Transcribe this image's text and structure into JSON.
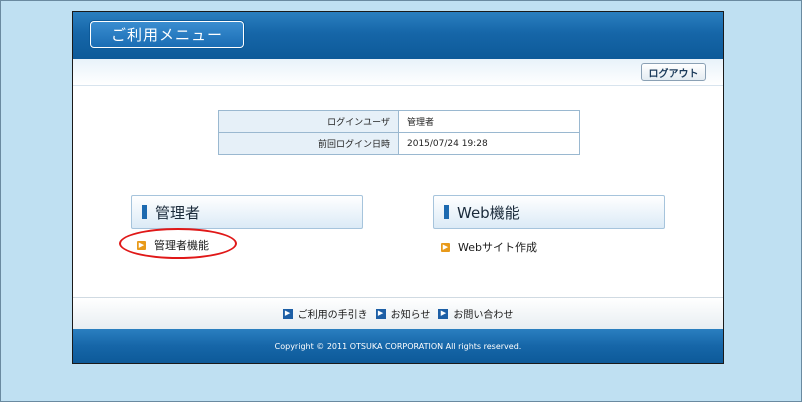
{
  "header": {
    "title": "ご利用メニュー"
  },
  "toolbar": {
    "logout_label": "ログアウト"
  },
  "login_info": {
    "user_label": "ログインユーザ",
    "user_value": "管理者",
    "last_login_label": "前回ログイン日時",
    "last_login_value": "2015/07/24 19:28"
  },
  "sections": {
    "admin": {
      "title": "管理者",
      "link": "管理者機能"
    },
    "web": {
      "title": "Web機能",
      "link": "Webサイト作成"
    }
  },
  "footer": {
    "links": [
      "ご利用の手引き",
      "お知らせ",
      "お問い合わせ"
    ],
    "copyright": "Copyright © 2011 OTSUKA CORPORATION All rights reserved."
  },
  "colors": {
    "brand_blue": "#1666a8",
    "accent_orange": "#e89a1a",
    "highlight_red": "#e01818"
  },
  "icons": {
    "section_marker": "blue-bar-icon",
    "link_arrow": "orange-arrow-icon",
    "footer_arrow": "blue-arrow-icon"
  }
}
